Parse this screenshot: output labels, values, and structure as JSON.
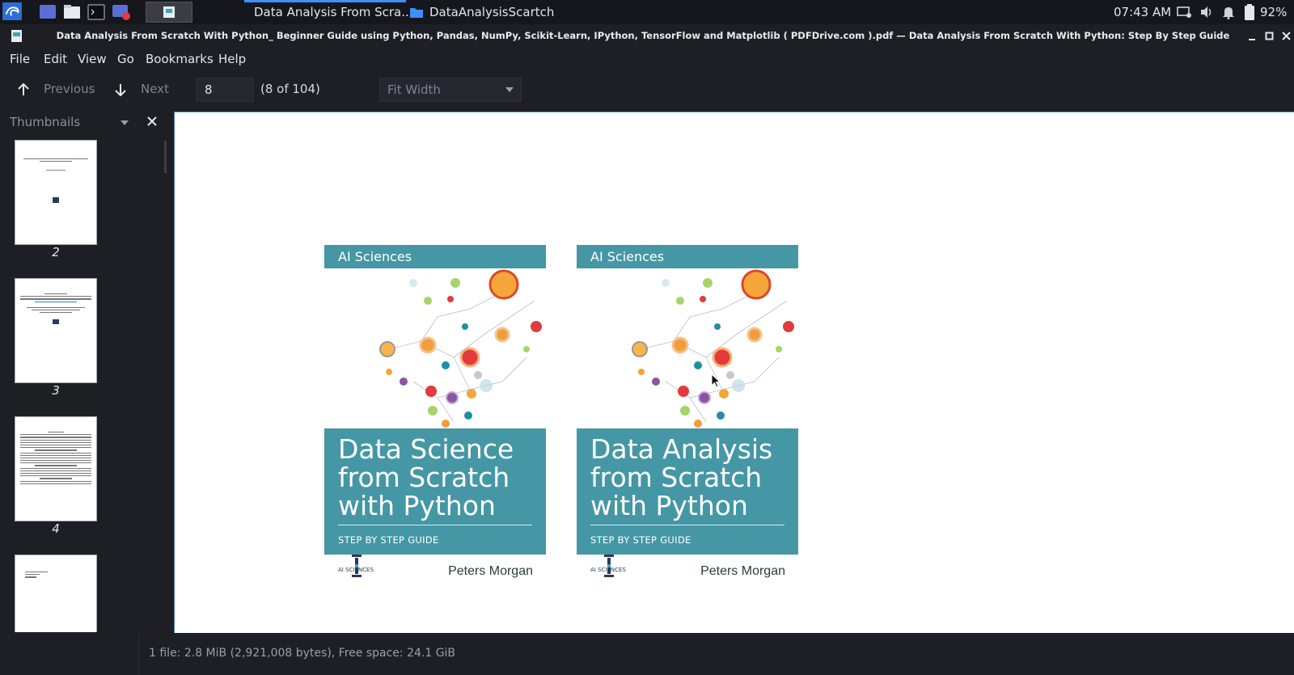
{
  "taskbar": {
    "tasks": [
      {
        "label": "Data Analysis From Scra...",
        "active": true
      },
      {
        "label": "DataAnalysisScartch",
        "active": false
      }
    ],
    "clock": "07:43 AM",
    "battery": "92%"
  },
  "window": {
    "title": "Data Analysis From Scratch With Python_ Beginner Guide using Python, Pandas, NumPy, Scikit-Learn, IPython, TensorFlow and Matplotlib ( PDFDrive.com ).pdf — Data Analysis From Scratch With Python: Step By Step Guide"
  },
  "menu": {
    "file": "File",
    "edit": "Edit",
    "view": "View",
    "go": "Go",
    "bookmarks": "Bookmarks",
    "help": "Help"
  },
  "toolbar": {
    "previous": "Previous",
    "next": "Next",
    "page_value": "8",
    "page_count": "(8 of 104)",
    "zoom": "Fit Width"
  },
  "sidebar": {
    "header": "Thumbnails",
    "thumbs": [
      {
        "page": "2"
      },
      {
        "page": "3"
      },
      {
        "page": "4"
      }
    ]
  },
  "covers": [
    {
      "publisher": "AI Sciences",
      "title_lines": [
        "Data Science",
        "from Scratch",
        "with Python"
      ],
      "subtitle": "STEP BY STEP GUIDE",
      "logo": "AI SCIENCES",
      "author": "Peters Morgan"
    },
    {
      "publisher": "AI Sciences",
      "title_lines": [
        "Data Analysis",
        "from Scratch",
        "with Python"
      ],
      "subtitle": "STEP BY STEP GUIDE",
      "logo": "AI SCIENCES",
      "author": "Peters Morgan"
    }
  ],
  "status": {
    "text": "1 file: 2.8 MiB (2,921,008 bytes), Free space: 24.1 GiB"
  },
  "colors": {
    "cover_teal": "#4597a5",
    "accent_blue": "#3f8fff"
  }
}
